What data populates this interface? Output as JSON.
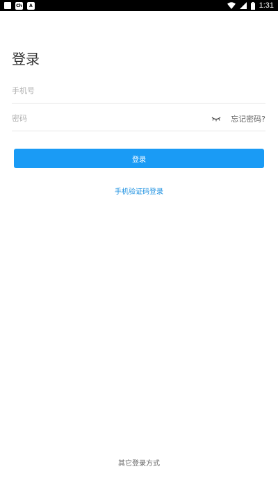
{
  "status_bar": {
    "notif_badge_1": "Ch",
    "notif_badge_2": "A",
    "time": "1:31"
  },
  "title": "登录",
  "phone_field": {
    "placeholder": "手机号",
    "value": ""
  },
  "password_field": {
    "placeholder": "密码",
    "value": ""
  },
  "forgot_password": "忘记密码?",
  "login_button": "登录",
  "sms_login": "手机验证码登录",
  "other_login": "其它登录方式",
  "colors": {
    "accent": "#1a9bf5",
    "link": "#1a8fe0",
    "status_bar": "#000000"
  },
  "icons": {
    "eye": "eye-closed-icon",
    "wifi": "wifi-icon",
    "signal": "signal-icon",
    "battery": "battery-icon"
  }
}
